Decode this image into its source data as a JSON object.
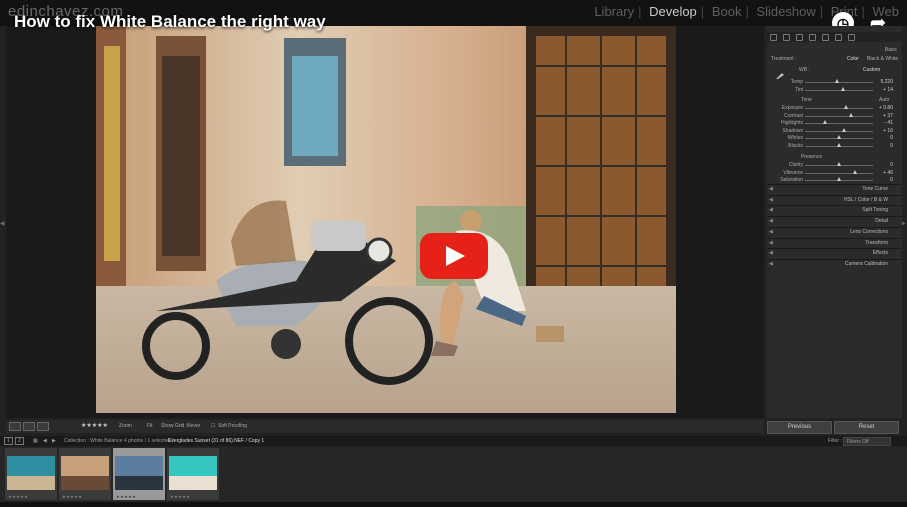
{
  "video": {
    "title": "How to fix White Balance the right way",
    "watch_later_icon": "clock-icon",
    "share_icon": "share-arrow-icon",
    "play_icon": "youtube-play-icon",
    "play_color": "#e62117"
  },
  "app": {
    "brand": "edinchavez.com",
    "modules": [
      {
        "label": "Library",
        "active": false
      },
      {
        "label": "Develop",
        "active": true
      },
      {
        "label": "Book",
        "active": false
      },
      {
        "label": "Slideshow",
        "active": false
      },
      {
        "label": "Print",
        "active": false
      },
      {
        "label": "Web",
        "active": false
      }
    ]
  },
  "panel": {
    "section_basic": "Basic",
    "treatment_label": "Treatment :",
    "treatment_color": "Color",
    "treatment_bw": "Black & White",
    "wb_label": "WB :",
    "wb_value": "Custom",
    "wb_sliders": [
      {
        "label": "Temp",
        "value": "5,220",
        "pos": 0.47
      },
      {
        "label": "Tint",
        "value": "+ 14",
        "pos": 0.56
      }
    ],
    "tone_label": "Tone",
    "tone_auto": "Auto",
    "tone_sliders": [
      {
        "label": "Exposure",
        "value": "+ 0.80",
        "pos": 0.6
      },
      {
        "label": "Contrast",
        "value": "+ 37",
        "pos": 0.68
      },
      {
        "label": "Highlights",
        "value": "- 41",
        "pos": 0.3
      },
      {
        "label": "Shadows",
        "value": "+ 16",
        "pos": 0.58
      },
      {
        "label": "Whites",
        "value": "0",
        "pos": 0.5
      },
      {
        "label": "Blacks",
        "value": "0",
        "pos": 0.5
      }
    ],
    "presence_label": "Presence",
    "presence_sliders": [
      {
        "label": "Clarity",
        "value": "0",
        "pos": 0.5
      },
      {
        "label": "Vibrance",
        "value": "+ 46",
        "pos": 0.73
      },
      {
        "label": "Saturation",
        "value": "0",
        "pos": 0.5
      }
    ],
    "sections": [
      "Tone Curve",
      "HSL / Color / B & W",
      "Split Toning",
      "Detail",
      "Lens Corrections",
      "Transform",
      "Effects",
      "Camera Calibration"
    ],
    "previous_button": "Previous",
    "reset_button": "Reset"
  },
  "toolbar": {
    "rating": "★★★★★",
    "zoom_label": "Zoom",
    "zoom_value": "Fit",
    "show_grid_label": "Show Grid :",
    "show_grid_value": "Never",
    "soft_proofing": "Soft Proofing"
  },
  "filmbar": {
    "page1": "1",
    "page2": "2",
    "collection": "Collection : White Balance",
    "photos": "4 photos / 1 selected /",
    "filename": "Everglades Sunset (31 of 86).NEF / Copy 1",
    "filter_label": "Filter :",
    "filter_value": "Filters Off"
  },
  "filmstrip": [
    {
      "name": "aerial-ocean",
      "stars": "★★★★★",
      "selected": false,
      "colors": [
        "#2f8fa0",
        "#c9b58f"
      ]
    },
    {
      "name": "havana-street",
      "stars": "★★★★★",
      "selected": false,
      "colors": [
        "#c8a07a",
        "#6a4a36"
      ]
    },
    {
      "name": "everglades-sunset",
      "stars": "★★★★★",
      "selected": true,
      "colors": [
        "#5c7da0",
        "#2a3540"
      ]
    },
    {
      "name": "beach-boat",
      "stars": "★★★★★",
      "selected": false,
      "colors": [
        "#36c6c0",
        "#eae0d2"
      ]
    }
  ]
}
